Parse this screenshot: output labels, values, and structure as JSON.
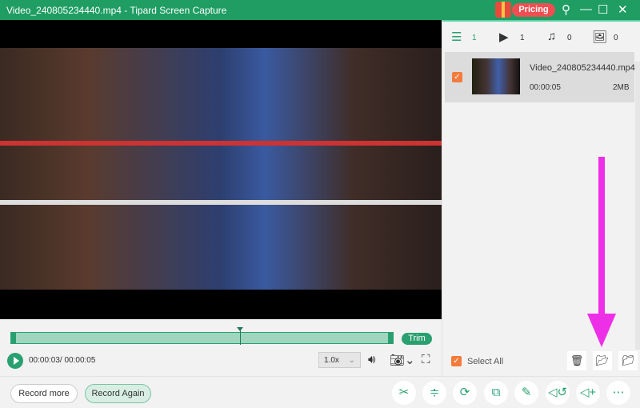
{
  "title_bar": {
    "title": "Video_240805234440.mp4  -  Tipard Screen Capture",
    "pricing": "Pricing",
    "icons": [
      "gift-icon",
      "key-icon",
      "minimize-icon",
      "maximize-icon",
      "close-icon"
    ]
  },
  "player": {
    "current_time": "00:00:03/ 00:00:05",
    "speed": "1.0x",
    "trim": "Trim",
    "progress_fraction": 0.6,
    "accent": "#2aa070"
  },
  "tabs": [
    {
      "icon": "list-icon",
      "count": "1"
    },
    {
      "icon": "video-icon",
      "count": "1"
    },
    {
      "icon": "music-icon",
      "count": "0"
    },
    {
      "icon": "image-icon",
      "count": "0"
    }
  ],
  "files": [
    {
      "name": "Video_240805234440.mp4",
      "duration": "00:00:05",
      "size": "2MB",
      "checked": true
    }
  ],
  "side": {
    "select_all": "Select All"
  },
  "bottom": {
    "record_more": "Record more",
    "record_again": "Record Again"
  },
  "colors": {
    "title_bar": "#1f9d63",
    "pricing": "#ef4e52",
    "checkbox": "#f37b3b",
    "arrow": "#ee2fe8"
  }
}
